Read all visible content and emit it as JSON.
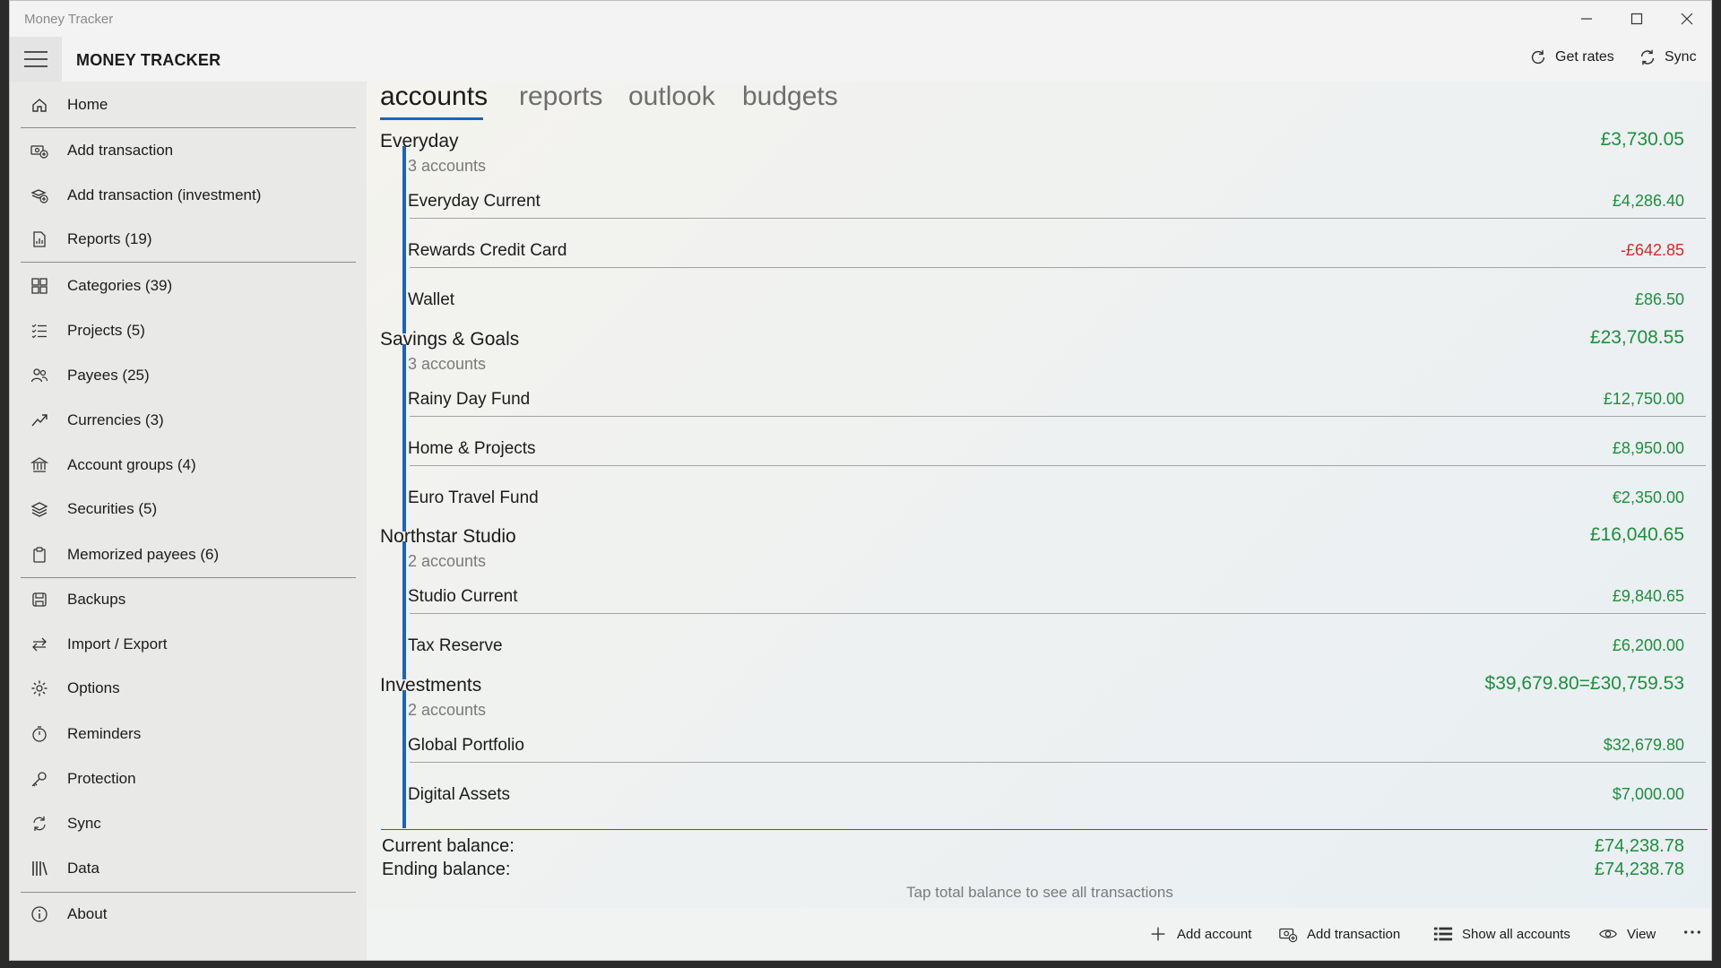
{
  "window": {
    "title": "Money Tracker"
  },
  "header": {
    "brand": "MONEY TRACKER",
    "get_rates": "Get rates",
    "sync": "Sync"
  },
  "sidebar": {
    "items": [
      {
        "label": "Home",
        "icon": "home-icon"
      },
      {
        "label": "Add transaction",
        "icon": "add-transaction-icon"
      },
      {
        "label": "Add transaction (investment)",
        "icon": "add-investment-icon"
      },
      {
        "label": "Reports (19)",
        "icon": "reports-icon"
      },
      {
        "label": "Categories (39)",
        "icon": "categories-icon"
      },
      {
        "label": "Projects (5)",
        "icon": "projects-icon"
      },
      {
        "label": "Payees (25)",
        "icon": "payees-icon"
      },
      {
        "label": "Currencies (3)",
        "icon": "currencies-icon"
      },
      {
        "label": "Account groups (4)",
        "icon": "bank-icon"
      },
      {
        "label": "Securities (5)",
        "icon": "securities-icon"
      },
      {
        "label": "Memorized payees (6)",
        "icon": "clipboard-icon"
      },
      {
        "label": "Backups",
        "icon": "backup-icon"
      },
      {
        "label": "Import / Export",
        "icon": "import-export-icon"
      },
      {
        "label": "Options",
        "icon": "gear-icon"
      },
      {
        "label": "Reminders",
        "icon": "stopwatch-icon"
      },
      {
        "label": "Protection",
        "icon": "key-icon"
      },
      {
        "label": "Sync",
        "icon": "sync-icon"
      },
      {
        "label": "Data",
        "icon": "data-icon"
      },
      {
        "label": "About",
        "icon": "info-icon"
      }
    ]
  },
  "tabs": [
    "accounts",
    "reports",
    "outlook",
    "budgets"
  ],
  "groups": [
    {
      "name": "Everyday",
      "total": "£3,730.05",
      "count": "3 accounts",
      "accounts": [
        {
          "name": "Everyday Current",
          "balance": "£4,286.40",
          "negative": false
        },
        {
          "name": "Rewards Credit Card",
          "balance": "-£642.85",
          "negative": true
        },
        {
          "name": "Wallet",
          "balance": "£86.50",
          "negative": false
        }
      ]
    },
    {
      "name": "Savings & Goals",
      "total": "£23,708.55",
      "count": "3 accounts",
      "accounts": [
        {
          "name": "Rainy Day Fund",
          "balance": "£12,750.00",
          "negative": false
        },
        {
          "name": "Home & Projects",
          "balance": "£8,950.00",
          "negative": false
        },
        {
          "name": "Euro Travel Fund",
          "balance": "€2,350.00",
          "negative": false
        }
      ]
    },
    {
      "name": "Northstar Studio",
      "total": "£16,040.65",
      "count": "2 accounts",
      "accounts": [
        {
          "name": "Studio Current",
          "balance": "£9,840.65",
          "negative": false
        },
        {
          "name": "Tax Reserve",
          "balance": "£6,200.00",
          "negative": false
        }
      ]
    },
    {
      "name": "Investments",
      "total": "$39,679.80=£30,759.53",
      "count": "2 accounts",
      "accounts": [
        {
          "name": "Global Portfolio",
          "balance": "$32,679.80",
          "negative": false
        },
        {
          "name": "Digital Assets",
          "balance": "$7,000.00",
          "negative": false
        }
      ]
    }
  ],
  "summary": {
    "current_label": "Current balance:",
    "current_value": "£74,238.78",
    "ending_label": "Ending balance:",
    "ending_value": "£74,238.78",
    "hint": "Tap total balance to see all transactions"
  },
  "bottom": {
    "add_account": "Add account",
    "add_transaction": "Add transaction",
    "show_all": "Show all accounts",
    "view": "View"
  },
  "colors": {
    "accent": "#1e63b8",
    "positive": "#1f8e3d",
    "negative": "#d32a2a"
  }
}
